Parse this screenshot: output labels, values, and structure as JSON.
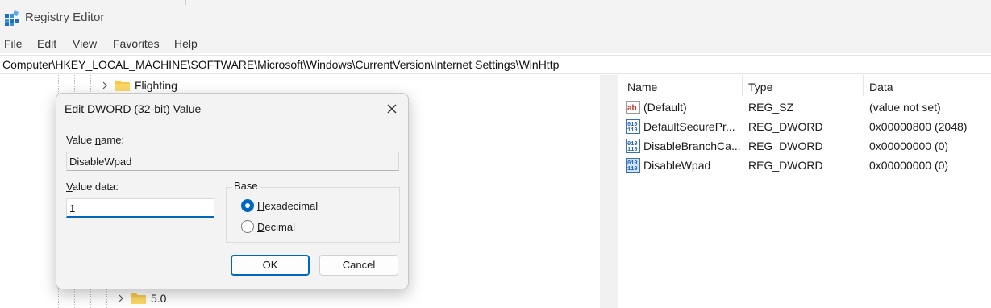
{
  "window": {
    "title": "Registry Editor"
  },
  "menu": [
    "File",
    "Edit",
    "View",
    "Favorites",
    "Help"
  ],
  "address": {
    "path": "Computer\\HKEY_LOCAL_MACHINE\\SOFTWARE\\Microsoft\\Windows\\CurrentVersion\\Internet Settings\\WinHttp"
  },
  "tree": {
    "items": [
      {
        "label": "Flighting"
      },
      {
        "label": "5.0"
      }
    ]
  },
  "values_pane": {
    "columns": {
      "name": "Name",
      "type": "Type",
      "data": "Data"
    },
    "rows": [
      {
        "name": "(Default)",
        "type": "REG_SZ",
        "data": "(value not set)",
        "icon": "string-value-icon"
      },
      {
        "name": "DefaultSecurePr...",
        "type": "REG_DWORD",
        "data": "0x00000800 (2048)",
        "icon": "binary-value-icon"
      },
      {
        "name": "DisableBranchCa...",
        "type": "REG_DWORD",
        "data": "0x00000000 (0)",
        "icon": "binary-value-icon"
      },
      {
        "name": "DisableWpad",
        "type": "REG_DWORD",
        "data": "0x00000000 (0)",
        "icon": "binary-value-icon"
      }
    ]
  },
  "dialog": {
    "title": "Edit DWORD (32-bit) Value",
    "value_name_label_pre": "Value ",
    "value_name_label_u": "n",
    "value_name_label_post": "ame:",
    "value_name": "DisableWpad",
    "value_data_label_u": "V",
    "value_data_label_post": "alue data:",
    "value_data": "1",
    "base_label": "Base",
    "hex_u": "H",
    "hex_post": "exadecimal",
    "dec_u": "D",
    "dec_post": "ecimal",
    "base_selected": "Hexadecimal",
    "ok_label": "OK",
    "cancel_label": "Cancel"
  },
  "colors": {
    "accent": "#0067c0",
    "folder": "#f7c94a",
    "chrome": "#f3f3f3"
  }
}
